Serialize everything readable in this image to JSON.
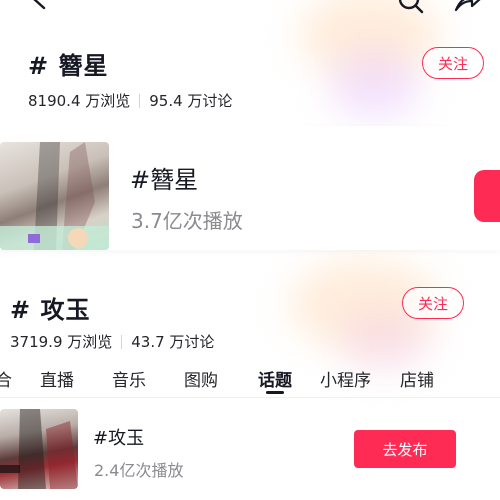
{
  "topic1": {
    "title": "# 簪星",
    "views": "8190.4 万浏览",
    "discussions": "95.4 万讨论",
    "follow_label": "关注"
  },
  "card": {
    "title": "#簪星",
    "plays": "3.7亿次播放"
  },
  "topic2": {
    "title": "# 攻玉",
    "views": "3719.9 万浏览",
    "discussions": "43.7 万讨论",
    "follow_label": "关注"
  },
  "tabs": [
    {
      "label": "综合"
    },
    {
      "label": "直播"
    },
    {
      "label": "音乐"
    },
    {
      "label": "图购"
    },
    {
      "label": "话题",
      "active": true
    },
    {
      "label": "小程序"
    },
    {
      "label": "店铺"
    }
  ],
  "row": {
    "title": "#攻玉",
    "plays": "2.4亿次播放",
    "publish_label": "去发布"
  },
  "colors": {
    "accent": "#fe2c55",
    "text": "#161823",
    "muted": "#8a8b91"
  },
  "icons": [
    "back-arrow-icon",
    "search-icon",
    "share-icon",
    "video-thumbnail-icon"
  ]
}
